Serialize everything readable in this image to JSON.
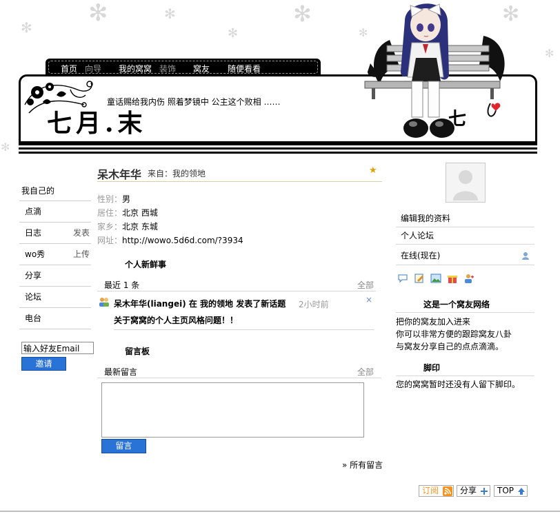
{
  "nav": {
    "home": "首页",
    "guide": "向导",
    "my_nest": "我的窝窝",
    "decorate": "装饰",
    "friends": "窝友",
    "browse": "随便看看"
  },
  "banner": {
    "motto": "童话赐给我内伤 照着梦镜中 公主这个败相 ……",
    "title": "七月.末",
    "tag_letter": "七"
  },
  "sidebar": {
    "title": "我自己的",
    "items": [
      {
        "label": "点滴",
        "extra": ""
      },
      {
        "label": "日志",
        "extra": "发表"
      },
      {
        "label": "wo秀",
        "extra": "上传"
      },
      {
        "label": "分享",
        "extra": ""
      },
      {
        "label": "论坛",
        "extra": ""
      },
      {
        "label": "电台",
        "extra": ""
      }
    ],
    "invite_value": "输入好友Email",
    "invite_button": "邀请"
  },
  "profile": {
    "name": "呆木年华",
    "source": "来自：我的领地",
    "fields": [
      {
        "label": "性别：",
        "value": "男"
      },
      {
        "label": "居住：",
        "value": "北京 西城"
      },
      {
        "label": "家乡：",
        "value": "北京 东城"
      },
      {
        "label": "网址：",
        "value": "http://wowo.5d6d.com/?3934"
      }
    ]
  },
  "feed": {
    "title": "个人新鲜事",
    "recent": "最近 1 条",
    "all": "全部",
    "item_text": "呆木年华(liangei) 在 我的领地 发表了新话题",
    "item_time": "2小时前",
    "item_close": "×",
    "item_topic": "关于窝窝的个人主页风格问题！！"
  },
  "guestbook": {
    "title": "留言板",
    "latest": "最新留言",
    "all": "全部",
    "submit": "留言",
    "all_messages": "» 所有留言"
  },
  "right": {
    "edit_profile": "编辑我的资料",
    "forum": "个人论坛",
    "online": "在线(现在)",
    "network_title": "这是一个窝友网络",
    "network_lines": [
      "把你的窝友加入进来",
      "你可以非常方便的跟踪窝友八卦",
      "与窝友分享自己的点点滴滴。"
    ],
    "footprint_title": "脚印",
    "footprint_text": "您的窝窝暂时还没有人留下脚印。"
  },
  "footer": {
    "subscribe": "订阅",
    "share": "分享",
    "top": "TOP"
  },
  "colors": {
    "accent_button": "#2a73d6",
    "nav_bg": "#000000",
    "rss_orange": "#f7931e"
  }
}
